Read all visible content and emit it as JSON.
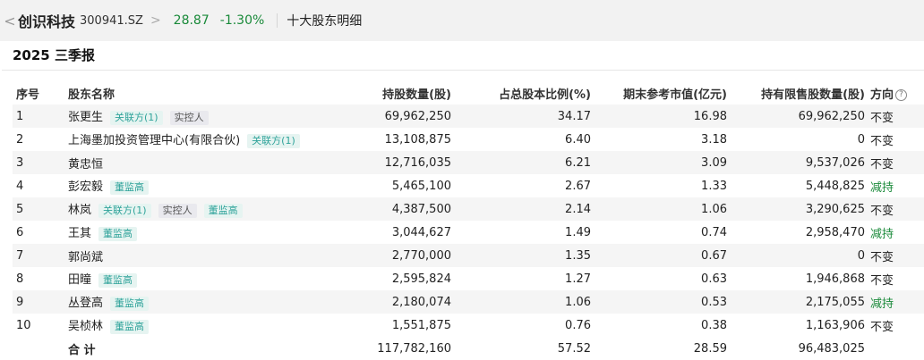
{
  "header": {
    "back_glyph": "<",
    "stock_name": "创识科技",
    "stock_code": "300941.SZ",
    "chevron_glyph": ">",
    "price": "28.87",
    "change": "-1.30%",
    "page_label": "十大股东明细"
  },
  "section": {
    "title": "2025 三季报"
  },
  "table": {
    "headers": {
      "index": "序号",
      "name": "股东名称",
      "shares": "持股数量(股)",
      "ratio": "占总股本比例(%)",
      "value": "期末参考市值(亿元)",
      "restricted": "持有限售股数量(股)",
      "direction": "方向"
    },
    "help_glyph": "?",
    "tags": {
      "related": "关联方(1)",
      "controller": "实控人",
      "executive": "董监高"
    },
    "rows": [
      {
        "index": "1",
        "name": "张更生",
        "shares": "69,962,250",
        "ratio": "34.17",
        "value": "16.98",
        "restricted": "69,962,250",
        "direction": "不变"
      },
      {
        "index": "2",
        "name": "上海墨加投资管理中心(有限合伙)",
        "shares": "13,108,875",
        "ratio": "6.40",
        "value": "3.18",
        "restricted": "0",
        "direction": "不变"
      },
      {
        "index": "3",
        "name": "黄忠恒",
        "shares": "12,716,035",
        "ratio": "6.21",
        "value": "3.09",
        "restricted": "9,537,026",
        "direction": "不变"
      },
      {
        "index": "4",
        "name": "彭宏毅",
        "shares": "5,465,100",
        "ratio": "2.67",
        "value": "1.33",
        "restricted": "5,448,825",
        "direction": "减持"
      },
      {
        "index": "5",
        "name": "林岚",
        "shares": "4,387,500",
        "ratio": "2.14",
        "value": "1.06",
        "restricted": "3,290,625",
        "direction": "不变"
      },
      {
        "index": "6",
        "name": "王其",
        "shares": "3,044,627",
        "ratio": "1.49",
        "value": "0.74",
        "restricted": "2,958,470",
        "direction": "减持"
      },
      {
        "index": "7",
        "name": "郭尚斌",
        "shares": "2,770,000",
        "ratio": "1.35",
        "value": "0.67",
        "restricted": "0",
        "direction": "不变"
      },
      {
        "index": "8",
        "name": "田曈",
        "shares": "2,595,824",
        "ratio": "1.27",
        "value": "0.63",
        "restricted": "1,946,868",
        "direction": "不变"
      },
      {
        "index": "9",
        "name": "丛登高",
        "shares": "2,180,074",
        "ratio": "1.06",
        "value": "0.53",
        "restricted": "2,175,055",
        "direction": "减持"
      },
      {
        "index": "10",
        "name": "吴桢林",
        "shares": "1,551,875",
        "ratio": "0.76",
        "value": "0.38",
        "restricted": "1,163,906",
        "direction": "不变"
      }
    ],
    "total": {
      "label": "合 计",
      "shares": "117,782,160",
      "ratio": "57.52",
      "value": "28.59",
      "restricted": "96,483,025"
    }
  },
  "colors": {
    "green": "#1a8a3a",
    "tag_teal": "#2fa39a",
    "row_stripe": "#f5f5f5"
  }
}
